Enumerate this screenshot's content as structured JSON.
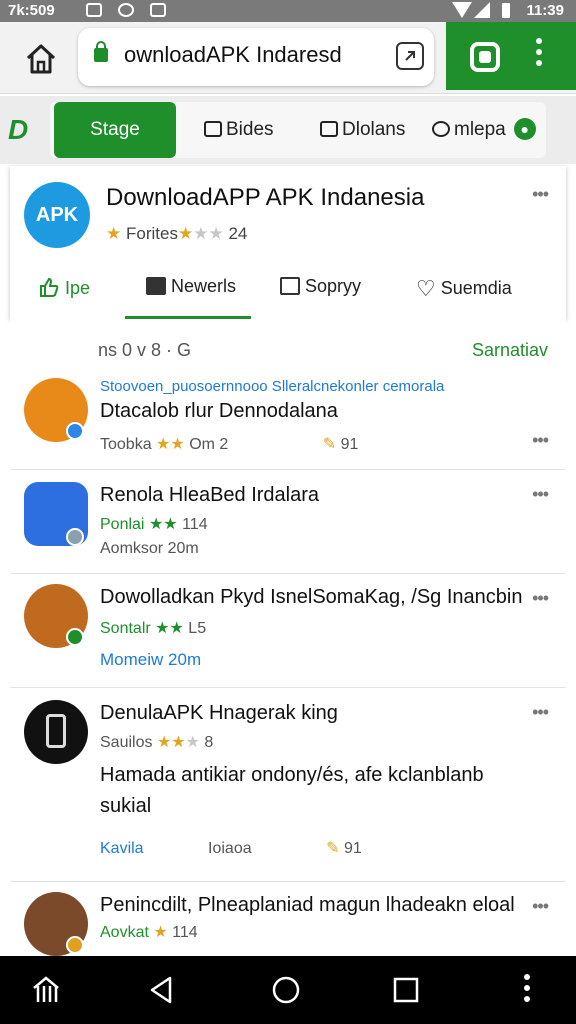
{
  "status_bar": {
    "time_left": "7k:509",
    "time_right": "11:39"
  },
  "browser": {
    "url": "ownloadAPK Indaresd",
    "tabs_count": ""
  },
  "nav": {
    "logo": "D",
    "tabs": [
      {
        "label": "Stage",
        "active": true
      },
      {
        "label": "Bides",
        "active": false
      },
      {
        "label": "Dlolans",
        "active": false
      },
      {
        "label": "mlepa",
        "active": false
      }
    ]
  },
  "card": {
    "logo_text": "APK",
    "title": "DownloadAPP APK Indanesia",
    "rating_label": "Forites",
    "rating_count": "24",
    "rating_stars": 3,
    "tabs": [
      {
        "label": "Ipe",
        "icon": "thumbs-up-icon"
      },
      {
        "label": "Newerls",
        "icon": "image-icon"
      },
      {
        "label": "Sopryy",
        "icon": "calendar-icon"
      },
      {
        "label": "Suemdia",
        "icon": "heart-icon"
      }
    ]
  },
  "list": {
    "header_left": "ns 0 v 8 · G",
    "header_right": "Sarnatiav",
    "items": [
      {
        "top_text": "Stoovoen_puosoernnooo Slleralcnekonler cemorala",
        "title": "Dtacalob rlur Dennodalana",
        "meta_label": "Toobka",
        "meta_value": "Om 2",
        "meta_right": "91",
        "icon_color": "#e88a1a",
        "badge_color": "#2b88e6"
      },
      {
        "title": "Renola HleaBed Irdalara",
        "sub_label": "Ponlai",
        "sub_value": "114",
        "meta_label": "Aomksor",
        "meta_value": "20m",
        "icon_color": "#2d6fe0",
        "badge_color": "#8aa0b0"
      },
      {
        "title": "Dowolladkan Pkyd IsnelSomaKag, /Sg Inancbin",
        "sub_label": "Sontalr",
        "sub_value": "L5",
        "meta_label": "Momeiw",
        "meta_value": "20m",
        "icon_color": "#c06a20",
        "badge_color": "#1f8f2b"
      },
      {
        "title": "DenulaAPK Hnagerak king",
        "sub_label": "Sauilos",
        "sub_value": "8",
        "description": "Hamada antikiar ondony/és, afe kclanblanb sukial",
        "meta_label": "Kavila",
        "meta_value": "Ioiaoa",
        "meta_right": "91",
        "icon_color": "#111111",
        "badge_color": ""
      },
      {
        "title": "Penincdilt, Plneaplaniad magun lhadeakn eloal",
        "sub_label": "Aovkat",
        "sub_value": "114",
        "icon_color": "#7a4a2a",
        "badge_color": "#e0a020"
      }
    ]
  },
  "colors": {
    "accent": "#1f8f2b",
    "link_blue": "#1e7ad6",
    "star": "#e2a520"
  }
}
